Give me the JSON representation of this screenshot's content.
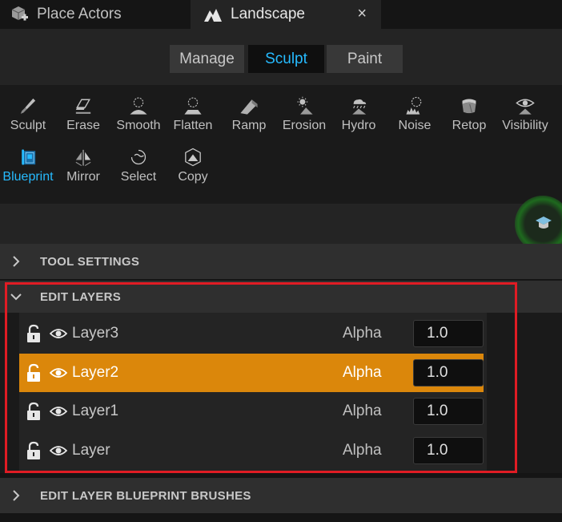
{
  "tabs": {
    "place_actors": "Place Actors",
    "landscape": "Landscape",
    "close_glyph": "×"
  },
  "modes": {
    "manage": "Manage",
    "sculpt": "Sculpt",
    "paint": "Paint",
    "active": "Sculpt"
  },
  "tools": [
    {
      "label": "Sculpt",
      "icon": "sculpt-brush-icon"
    },
    {
      "label": "Erase",
      "icon": "eraser-icon"
    },
    {
      "label": "Smooth",
      "icon": "smooth-icon"
    },
    {
      "label": "Flatten",
      "icon": "flatten-icon"
    },
    {
      "label": "Ramp",
      "icon": "ramp-icon"
    },
    {
      "label": "Erosion",
      "icon": "erosion-icon"
    },
    {
      "label": "Hydro",
      "icon": "hydro-icon"
    },
    {
      "label": "Noise",
      "icon": "noise-icon"
    },
    {
      "label": "Retop",
      "icon": "retopologize-icon"
    },
    {
      "label": "Visibility",
      "icon": "visibility-icon"
    },
    {
      "label": "Blueprint",
      "icon": "blueprint-icon",
      "active": true
    },
    {
      "label": "Mirror",
      "icon": "mirror-icon"
    },
    {
      "label": "Select",
      "icon": "select-icon"
    },
    {
      "label": "Copy",
      "icon": "copy-icon"
    }
  ],
  "sections": {
    "tool_settings": "TOOL SETTINGS",
    "edit_layers": "EDIT LAYERS",
    "bp_brushes": "EDIT LAYER BLUEPRINT BRUSHES"
  },
  "layers": [
    {
      "name": "Layer3",
      "alpha_label": "Alpha",
      "alpha": "1.0",
      "selected": false
    },
    {
      "name": "Layer2",
      "alpha_label": "Alpha",
      "alpha": "1.0",
      "selected": true
    },
    {
      "name": "Layer1",
      "alpha_label": "Alpha",
      "alpha": "1.0",
      "selected": false
    },
    {
      "name": "Layer",
      "alpha_label": "Alpha",
      "alpha": "1.0",
      "selected": false
    }
  ],
  "colors": {
    "accent": "#26bbff",
    "selected_row": "#db870b",
    "highlight_box": "#e01c24"
  }
}
